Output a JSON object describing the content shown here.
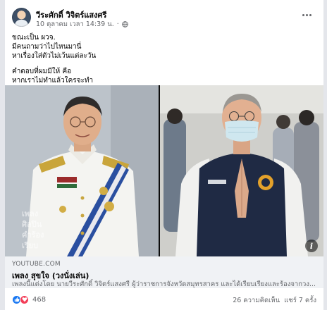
{
  "post": {
    "author": "วีระศักดิ์ วิจิตร์แสงศรี",
    "timestamp": "10 ตุลาคม เวลา 14:39 น.",
    "separator": "·",
    "privacy_icon": "globe-icon",
    "more_icon": "more-options-icon",
    "text_lines": [
      "ขณะเป็น ผวจ.",
      "มีคนถามว่าไปไหนมานี่",
      "หาเรื่องใส่ตัวไม่เว้นแต่ละวัน",
      "",
      "คำตอบที่ผมมีให้ คือ",
      "หากเราไม่ทำแล้วใครจะทำ"
    ]
  },
  "media": {
    "overlay_lines": [
      "เพลง",
      "ศิลปิน",
      "คำร้อง",
      "เรียบ"
    ],
    "info_icon": "info-icon"
  },
  "link_preview": {
    "domain": "YOUTUBE.COM",
    "title": "เพลง สุขใจ (วงนั่งเล่น)",
    "description": "เพลงนี้แต่งโดย นายวีระศักดิ์ วิจิตร์แสงศรี ผู้ว่าราชการจังหวัดสมุทรสาคร และได้เรียบเรียงและร้องจากวง..."
  },
  "footer": {
    "reaction_icons": [
      "like-icon",
      "love-icon"
    ],
    "reaction_count": "468",
    "comments": "26 ความคิดเห็น",
    "shares": "แชร์ 7 ครั้ง"
  },
  "colors": {
    "accent": "#1877f2",
    "love": "#f33e58",
    "secondary_text": "#65676b",
    "link_bg": "#f0f2f5"
  }
}
